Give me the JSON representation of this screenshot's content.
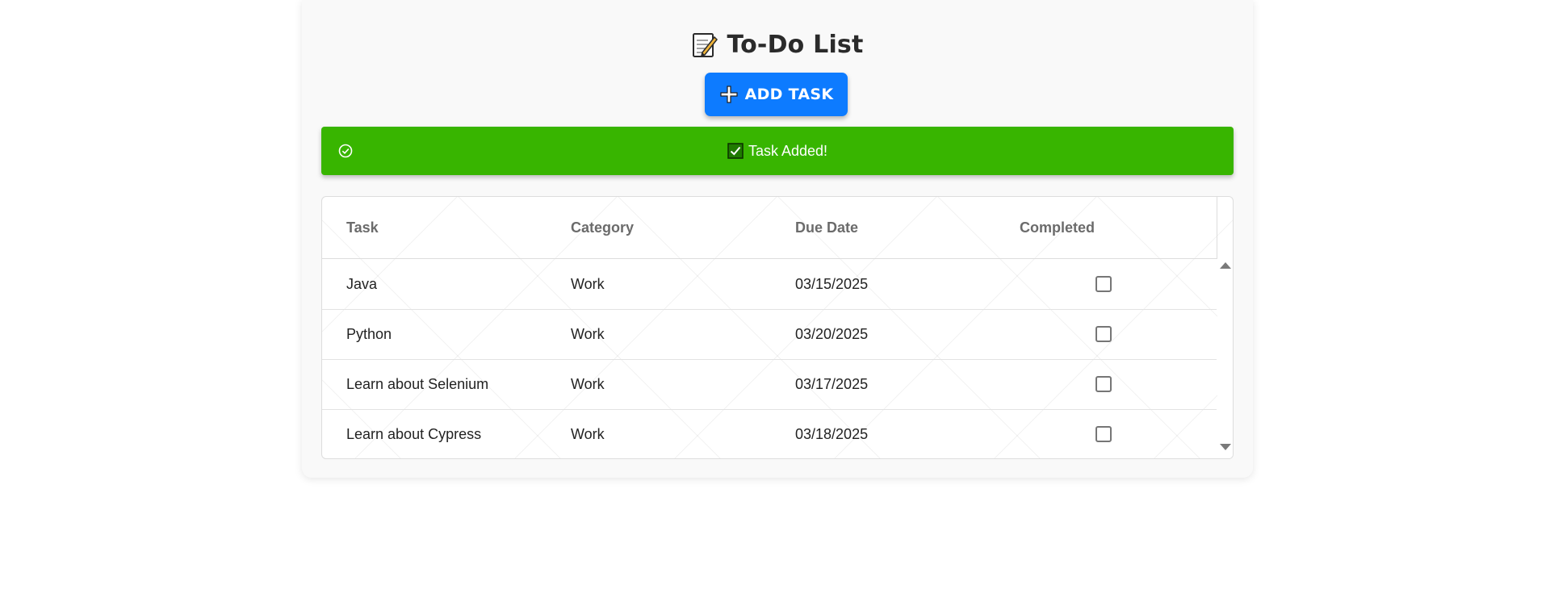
{
  "app": {
    "title": "To-Do List",
    "title_icon": "memo-icon"
  },
  "toolbar": {
    "add_label": "ADD TASK",
    "add_icon": "plus-icon",
    "add_color": "#0d7bff"
  },
  "toast": {
    "message": "Task Added!",
    "icon": "check-circle-icon",
    "message_icon": "checked-box-icon",
    "color": "#38b500"
  },
  "table": {
    "columns": [
      "Task",
      "Category",
      "Due Date",
      "Completed"
    ],
    "rows": [
      {
        "task": "Java",
        "category": "Work",
        "due": "03/15/2025",
        "completed": false
      },
      {
        "task": "Python",
        "category": "Work",
        "due": "03/20/2025",
        "completed": false
      },
      {
        "task": "Learn about Selenium",
        "category": "Work",
        "due": "03/17/2025",
        "completed": false
      },
      {
        "task": "Learn about Cypress",
        "category": "Work",
        "due": "03/18/2025",
        "completed": false
      }
    ]
  }
}
